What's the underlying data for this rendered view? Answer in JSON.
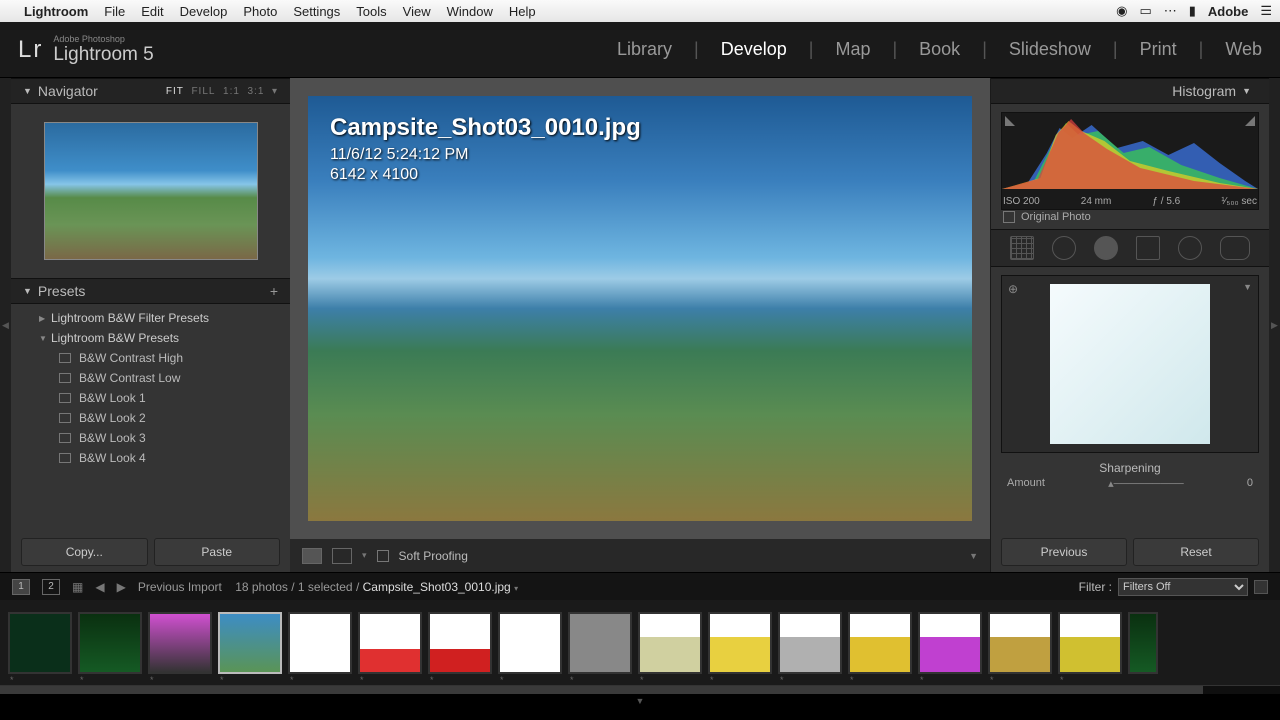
{
  "menubar": {
    "app": "Lightroom",
    "items": [
      "File",
      "Edit",
      "Develop",
      "Photo",
      "Settings",
      "Tools",
      "View",
      "Window",
      "Help"
    ],
    "right_brand": "Adobe"
  },
  "identity": {
    "logo": "Lr",
    "small": "Adobe Photoshop",
    "product": "Lightroom 5"
  },
  "modules": [
    "Library",
    "Develop",
    "Map",
    "Book",
    "Slideshow",
    "Print",
    "Web"
  ],
  "active_module": "Develop",
  "navigator": {
    "title": "Navigator",
    "zoom_fit": "FIT",
    "zoom_fill": "FILL",
    "zoom_1": "1:1",
    "zoom_3": "3:1"
  },
  "presets": {
    "title": "Presets",
    "groups": [
      {
        "label": "Lightroom B&W Filter Presets",
        "open": false
      },
      {
        "label": "Lightroom B&W Presets",
        "open": true
      }
    ],
    "items": [
      "B&W Contrast High",
      "B&W Contrast Low",
      "B&W Look 1",
      "B&W Look 2",
      "B&W Look 3",
      "B&W Look 4"
    ]
  },
  "left_buttons": {
    "copy": "Copy...",
    "paste": "Paste"
  },
  "image": {
    "filename": "Campsite_Shot03_0010.jpg",
    "timestamp": "11/6/12 5:24:12 PM",
    "dimensions": "6142 x 4100"
  },
  "center_toolbar": {
    "soft_proofing": "Soft Proofing"
  },
  "histogram": {
    "title": "Histogram",
    "iso": "ISO 200",
    "focal": "24 mm",
    "aperture": "ƒ / 5.6",
    "shutter": "¹⁄₅₀₀ sec",
    "original": "Original Photo"
  },
  "detail": {
    "section": "Sharpening",
    "amount_label": "Amount",
    "amount_value": "0"
  },
  "right_buttons": {
    "previous": "Previous",
    "reset": "Reset"
  },
  "secondary": {
    "view1": "1",
    "view2": "2",
    "source": "Previous Import",
    "count": "18 photos / 1 selected / ",
    "current": "Campsite_Shot03_0010.jpg",
    "filter_label": "Filter :",
    "filter_value": "Filters Off"
  },
  "filmstrip": {
    "thumbs": 17
  }
}
